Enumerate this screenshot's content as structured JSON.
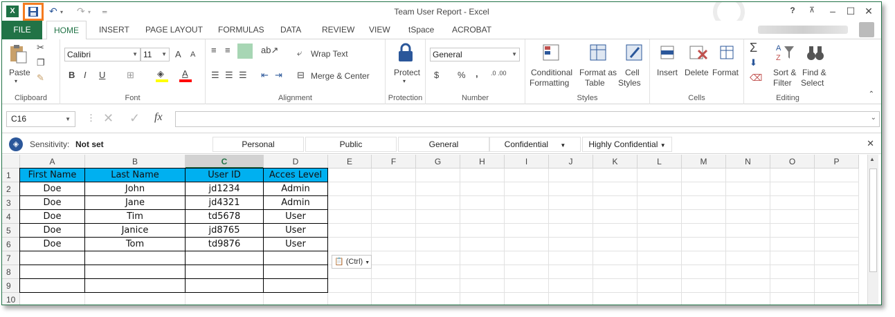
{
  "window": {
    "title": "Team User Report - Excel",
    "help": "?",
    "accent": "#217346"
  },
  "qat": {
    "app_icon": "excel-logo-icon",
    "save_icon": "floppy-save-icon",
    "undo_icon": "undo-icon",
    "redo_icon": "redo-icon",
    "customize_icon": "customize-qat-icon"
  },
  "tabs": {
    "file": "FILE",
    "items": [
      "HOME",
      "INSERT",
      "PAGE LAYOUT",
      "FORMULAS",
      "DATA",
      "REVIEW",
      "VIEW",
      "tSpace",
      "ACROBAT"
    ]
  },
  "ribbon": {
    "clipboard": {
      "paste": "Paste",
      "label": "Clipboard"
    },
    "font": {
      "name": "Calibri",
      "size": "11",
      "bold": "B",
      "italic": "I",
      "underline": "U",
      "grow": "A",
      "shrink": "A",
      "label": "Font"
    },
    "alignment": {
      "wrap_text": "Wrap Text",
      "merge_center": "Merge & Center",
      "label": "Alignment"
    },
    "protection": {
      "protect": "Protect",
      "label": "Protection"
    },
    "number": {
      "format": "General",
      "currency": "$",
      "percent": "%",
      "comma": ",",
      "inc_decimal": ".0 .00",
      "dec_decimal": ".00 .0",
      "label": "Number"
    },
    "styles": {
      "conditional_1": "Conditional",
      "conditional_2": "Formatting",
      "format_table_1": "Format as",
      "format_table_2": "Table",
      "cell_styles_1": "Cell",
      "cell_styles_2": "Styles",
      "label": "Styles"
    },
    "cells": {
      "insert": "Insert",
      "delete": "Delete",
      "format": "Format",
      "label": "Cells"
    },
    "editing": {
      "sum": "Σ",
      "sort_1": "Sort &",
      "sort_2": "Filter",
      "find_1": "Find &",
      "find_2": "Select",
      "label": "Editing"
    }
  },
  "formula_bar": {
    "name_box": "C16",
    "fx": "fx",
    "value": ""
  },
  "sensitivity": {
    "label": "Sensitivity:",
    "value": "Not set",
    "options": [
      "Personal",
      "Public",
      "General",
      "Confidential",
      "Highly Confidential"
    ]
  },
  "sheet": {
    "columns": [
      "A",
      "B",
      "C",
      "D",
      "E",
      "F",
      "G",
      "H",
      "I",
      "J",
      "K",
      "L",
      "M",
      "N",
      "O",
      "P"
    ],
    "selected_column": "C",
    "rows": [
      "1",
      "2",
      "3",
      "4",
      "5",
      "6",
      "7",
      "8",
      "9",
      "10"
    ],
    "header_fill": "#00b0f0",
    "table": [
      [
        "First Name",
        "Last Name",
        "User ID",
        "Acces Level"
      ],
      [
        "Doe",
        "John",
        "jd1234",
        "Admin"
      ],
      [
        "Doe",
        "Jane",
        "jd4321",
        "Admin"
      ],
      [
        "Doe",
        "Tim",
        "td5678",
        "User"
      ],
      [
        "Doe",
        "Janice",
        "jd8765",
        "User"
      ],
      [
        "Doe",
        "Tom",
        "td9876",
        "User"
      ]
    ],
    "paste_options": "(Ctrl)"
  }
}
